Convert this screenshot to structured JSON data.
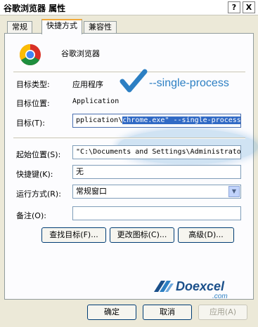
{
  "window": {
    "title": "谷歌浏览器 属性",
    "help_btn": "?",
    "close_btn": "X"
  },
  "tabs": [
    {
      "label": "常规"
    },
    {
      "label": "快捷方式"
    },
    {
      "label": "兼容性"
    }
  ],
  "shortcut": {
    "app_name": "谷歌浏览器",
    "target_type_label": "目标类型:",
    "target_type": "应用程序",
    "target_location_label": "目标位置:",
    "target_location": "Application",
    "target_label": "目标(T):",
    "target_value_pre": "pplication\\",
    "target_value_sel": "chrome.exe\" --single-process",
    "start_in_label": "起始位置(S):",
    "start_in_value": "\"C:\\Documents and Settings\\Administrato",
    "hotkey_label": "快捷键(K):",
    "hotkey_value": "无",
    "run_label": "运行方式(R):",
    "run_value": "常规窗口",
    "comment_label": "备注(O):",
    "comment_value": ""
  },
  "buttons": {
    "find_target": "查找目标(F)...",
    "change_icon": "更改图标(C)...",
    "advanced": "高级(D)...",
    "ok": "确定",
    "cancel": "取消",
    "apply": "应用(A)"
  },
  "annotation": {
    "text": "--single-process",
    "color": "#2c7fc3"
  },
  "logo": {
    "main": "Doexcel",
    "sub": ".com"
  }
}
